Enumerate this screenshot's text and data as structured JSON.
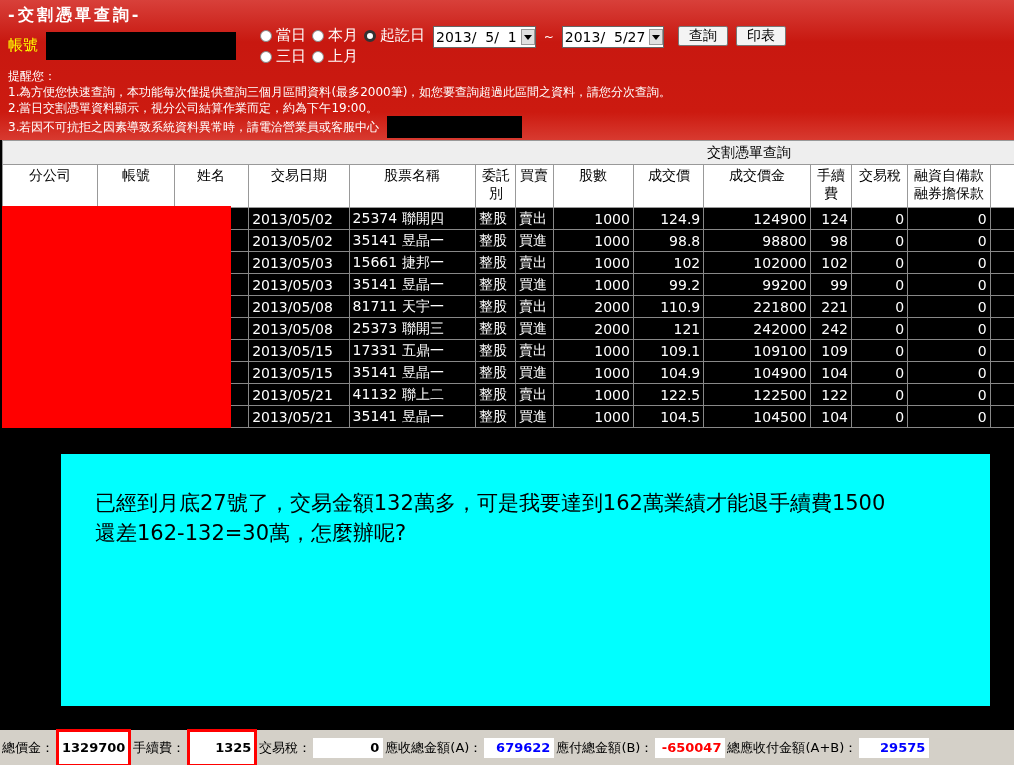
{
  "header": {
    "title": "-交割憑單查詢-",
    "account_label": "帳號",
    "range_options": [
      {
        "label": "當日",
        "selected": false
      },
      {
        "label": "本月",
        "selected": false
      },
      {
        "label": "起訖日",
        "selected": true
      },
      {
        "label": "三日",
        "selected": false
      },
      {
        "label": "上月",
        "selected": false
      }
    ],
    "date_from": "2013/  5/  1",
    "date_separator": "~",
    "date_to": "2013/  5/27",
    "buttons": [
      "查詢",
      "印表"
    ],
    "notice_title": "提醒您：",
    "notices": [
      "1.為方便您快速查詢，本功能每次僅提供查詢三個月區間資料(最多2000筆)，如您要查詢超過此區間之資料，請您分次查詢。",
      "2.當日交割憑單資料顯示，視分公司結算作業而定，約為下午19:00。",
      "3.若因不可抗拒之因素導致系統資料異常時，請電洽營業員或客服中心"
    ]
  },
  "table": {
    "caption": "交割憑單查詢",
    "columns": [
      "分公司",
      "帳號",
      "姓名",
      "交易日期",
      "股票名稱",
      "委託別",
      "買賣",
      "股數",
      "成交價",
      "成交價金",
      "手續費",
      "交易稅",
      "融資自備款融券擔保款"
    ],
    "rows": [
      [
        "",
        "",
        "",
        "2013/05/02",
        "25374 聯開四",
        "整股",
        "賣出",
        "1000",
        "124.9",
        "124900",
        "124",
        "0",
        "0"
      ],
      [
        "",
        "",
        "",
        "2013/05/02",
        "35141 昱晶一",
        "整股",
        "買進",
        "1000",
        "98.8",
        "98800",
        "98",
        "0",
        "0"
      ],
      [
        "",
        "",
        "",
        "2013/05/03",
        "15661 捷邦一",
        "整股",
        "賣出",
        "1000",
        "102",
        "102000",
        "102",
        "0",
        "0"
      ],
      [
        "",
        "",
        "",
        "2013/05/03",
        "35141 昱晶一",
        "整股",
        "買進",
        "1000",
        "99.2",
        "99200",
        "99",
        "0",
        "0"
      ],
      [
        "",
        "",
        "",
        "2013/05/08",
        "81711 天宇一",
        "整股",
        "賣出",
        "2000",
        "110.9",
        "221800",
        "221",
        "0",
        "0"
      ],
      [
        "",
        "",
        "",
        "2013/05/08",
        "25373 聯開三",
        "整股",
        "買進",
        "2000",
        "121",
        "242000",
        "242",
        "0",
        "0"
      ],
      [
        "",
        "",
        "",
        "2013/05/15",
        "17331 五鼎一",
        "整股",
        "賣出",
        "1000",
        "109.1",
        "109100",
        "109",
        "0",
        "0"
      ],
      [
        "",
        "",
        "",
        "2013/05/15",
        "35141 昱晶一",
        "整股",
        "買進",
        "1000",
        "104.9",
        "104900",
        "104",
        "0",
        "0"
      ],
      [
        "",
        "",
        "",
        "2013/05/21",
        "41132 聯上二",
        "整股",
        "賣出",
        "1000",
        "122.5",
        "122500",
        "122",
        "0",
        "0"
      ],
      [
        "",
        "",
        "",
        "2013/05/21",
        "35141 昱晶一",
        "整股",
        "買進",
        "1000",
        "104.5",
        "104500",
        "104",
        "0",
        "0"
      ]
    ]
  },
  "note": {
    "lines": [
      "已經到月底27號了，交易金額132萬多，可是我要達到162萬業績才能退手續費1500",
      "還差162-132=30萬，怎麼辦呢?"
    ]
  },
  "totals": [
    {
      "label": "總價金：",
      "value": "1329700",
      "color": "#000000",
      "highlighted": true
    },
    {
      "label": "手續費：",
      "value": "1325",
      "color": "#000000",
      "highlighted": true
    },
    {
      "label": "交易稅：",
      "value": "0",
      "color": "#000000",
      "highlighted": false
    },
    {
      "label": "應收總金額(A)：",
      "value": "679622",
      "color": "#0000ff",
      "highlighted": false
    },
    {
      "label": "應付總金額(B)：",
      "value": "-650047",
      "color": "#ff0000",
      "highlighted": false
    },
    {
      "label": "總應收付金額(A+B)：",
      "value": "29575",
      "color": "#0000ff",
      "highlighted": false
    }
  ]
}
